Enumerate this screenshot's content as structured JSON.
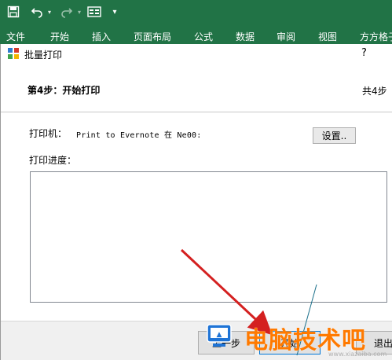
{
  "quick_access": {
    "save_icon": "save-icon",
    "undo_icon": "undo-icon",
    "redo_icon": "redo-icon",
    "form_icon": "form-icon",
    "customize_icon": "customize-qat-icon"
  },
  "ribbon": {
    "tabs": [
      {
        "label": "文件"
      },
      {
        "label": "开始"
      },
      {
        "label": "插入"
      },
      {
        "label": "页面布局"
      },
      {
        "label": "公式"
      },
      {
        "label": "数据"
      },
      {
        "label": "审阅"
      },
      {
        "label": "视图"
      },
      {
        "label": "方方格子"
      }
    ]
  },
  "dialog": {
    "title": "批量打印",
    "help": "?",
    "step_title": "第4步：开始打印",
    "step_count": "共4步",
    "printer_label": "打印机：",
    "printer_value": "Print to Evernote 在 Ne00:",
    "settings_button": "设置..",
    "progress_label": "打印进度：",
    "buttons": {
      "prev": "上一步",
      "start": "开始",
      "exit": "退出"
    }
  },
  "overlay": {
    "watermark": "电脑技术吧",
    "watermark_url": "www.xiazaiba.com",
    "arrow_color": "#d42020",
    "brand_color": "#ff7a00"
  },
  "colors": {
    "excel_green": "#217346",
    "accent_blue": "#0078d7"
  }
}
